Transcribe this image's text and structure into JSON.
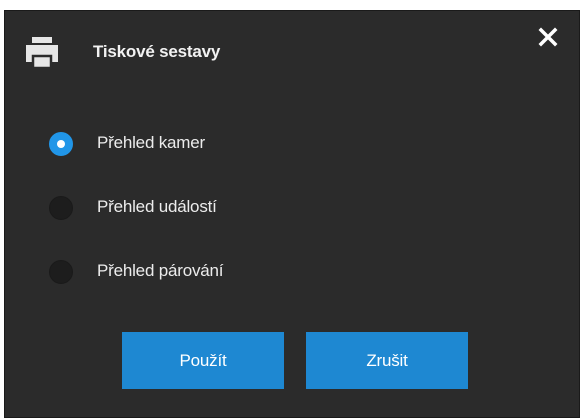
{
  "dialog": {
    "title": "Tiskové sestavy",
    "header_icon": "printer-icon",
    "close_icon": "close-icon",
    "accent_color": "#1e88d2",
    "background_color": "#2b2b2b"
  },
  "options": [
    {
      "label": "Přehled kamer",
      "checked": true
    },
    {
      "label": "Přehled událostí",
      "checked": false
    },
    {
      "label": "Přehled párování",
      "checked": false
    }
  ],
  "buttons": {
    "apply_label": "Použít",
    "cancel_label": "Zrušit"
  }
}
